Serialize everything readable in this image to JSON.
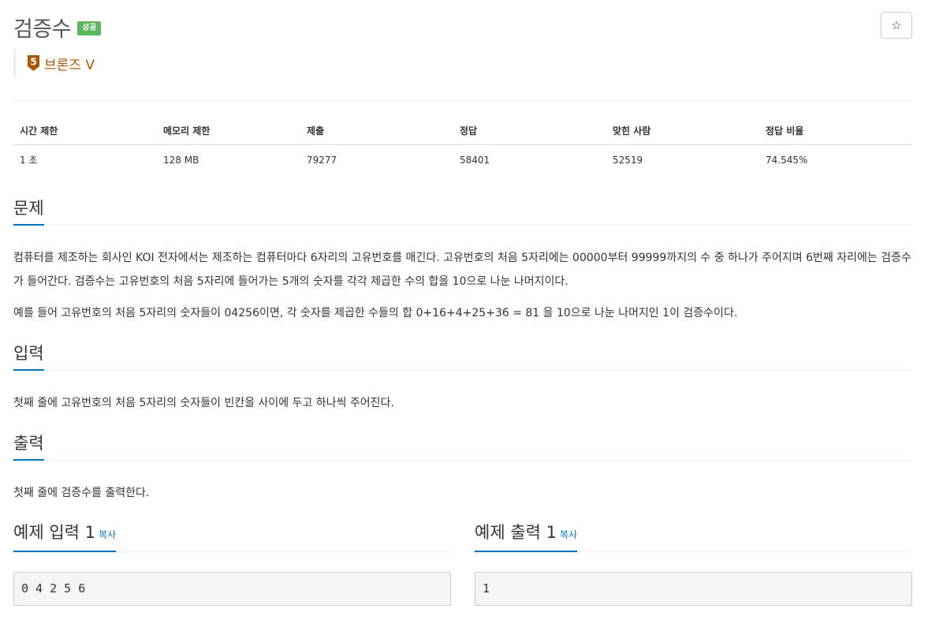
{
  "header": {
    "title": "검증수",
    "status": "성공",
    "star": "☆",
    "tier": {
      "number": "5",
      "label": "브론즈 V"
    }
  },
  "colors": {
    "accent": "#0076c0",
    "success": "#5cb85c",
    "bronze": "#ad5600"
  },
  "info_table": {
    "headers": [
      "시간 제한",
      "메모리 제한",
      "제출",
      "정답",
      "맞힌 사람",
      "정답 비율"
    ],
    "row": [
      "1 초",
      "128 MB",
      "79277",
      "58401",
      "52519",
      "74.545%"
    ]
  },
  "problem": {
    "title": "문제",
    "paragraphs": [
      "컴퓨터를 제조하는 회사인 KOI 전자에서는 제조하는 컴퓨터마다 6자리의 고유번호를 매긴다. 고유번호의 처음 5자리에는 00000부터 99999까지의 수 중 하나가 주어지며 6번째 자리에는 검증수가 들어간다. 검증수는 고유번호의 처음 5자리에 들어가는 5개의 숫자를 각각 제곱한 수의 합을 10으로 나눈 나머지이다.",
      "예를 들어 고유번호의 처음 5자리의 숫자들이 04256이면, 각 숫자를 제곱한 수들의 합 0+16+4+25+36 = 81 을 10으로 나눈 나머지인 1이 검증수이다."
    ]
  },
  "input": {
    "title": "입력",
    "text": "첫째 줄에 고유번호의 처음 5자리의 숫자들이 빈칸을 사이에 두고 하나씩 주어진다."
  },
  "output": {
    "title": "출력",
    "text": "첫째 줄에 검증수를 출력한다."
  },
  "samples": {
    "input_title": "예제 입력 1",
    "output_title": "예제 출력 1",
    "copy_label": "복사",
    "input_value": "0 4 2 5 6",
    "output_value": "1"
  }
}
